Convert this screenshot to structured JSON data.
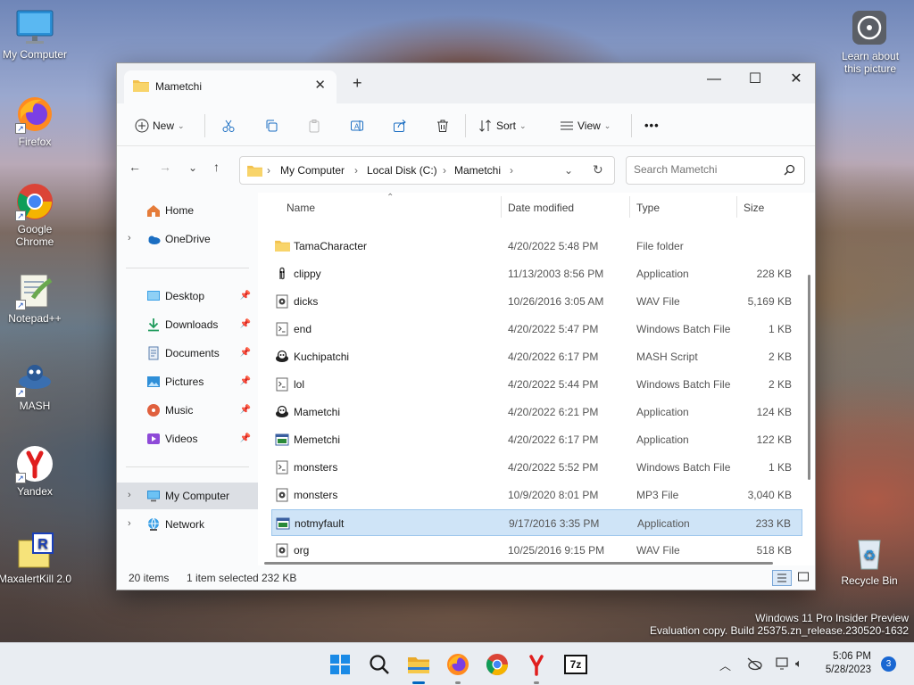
{
  "desktop": {
    "icons": [
      {
        "label": "My Computer"
      },
      {
        "label": "Firefox"
      },
      {
        "label": "Google Chrome"
      },
      {
        "label": "Notepad++"
      },
      {
        "label": "MASH"
      },
      {
        "label": "Yandex"
      },
      {
        "label": "MaxalertKill 2.0"
      },
      {
        "label": "Learn about this picture"
      },
      {
        "label": "Recycle Bin"
      }
    ],
    "watermark_line1": "Windows 11 Pro Insider Preview",
    "watermark_line2": "Evaluation copy. Build 25375.zn_release.230520-1632"
  },
  "window": {
    "tab_title": "Mametchi",
    "toolbar": {
      "new_label": "New",
      "sort_label": "Sort",
      "view_label": "View",
      "more_label": "•••"
    },
    "address": {
      "crumbs": [
        "My Computer",
        "Local Disk (C:)",
        "Mametchi"
      ]
    },
    "search_placeholder": "Search Mametchi",
    "nav": {
      "home": "Home",
      "onedrive": "OneDrive",
      "quick": [
        "Desktop",
        "Downloads",
        "Documents",
        "Pictures",
        "Music",
        "Videos"
      ],
      "my_computer": "My Computer",
      "network": "Network"
    },
    "columns": {
      "name": "Name",
      "date": "Date modified",
      "type": "Type",
      "size": "Size"
    },
    "files": [
      {
        "name": "TamaCharacter",
        "date": "4/20/2022 5:48 PM",
        "type": "File folder",
        "size": "",
        "icon": "folder-icon"
      },
      {
        "name": "clippy",
        "date": "11/13/2003 8:56 PM",
        "type": "Application",
        "size": "228 KB",
        "icon": "clippy-icon"
      },
      {
        "name": "dicks",
        "date": "10/26/2016 3:05 AM",
        "type": "WAV File",
        "size": "5,169 KB",
        "icon": "audio-file-icon"
      },
      {
        "name": "end",
        "date": "4/20/2022 5:47 PM",
        "type": "Windows Batch File",
        "size": "1 KB",
        "icon": "batch-file-icon"
      },
      {
        "name": "Kuchipatchi",
        "date": "4/20/2022 6:17 PM",
        "type": "MASH Script",
        "size": "2 KB",
        "icon": "mash-icon"
      },
      {
        "name": "lol",
        "date": "4/20/2022 5:44 PM",
        "type": "Windows Batch File",
        "size": "2 KB",
        "icon": "batch-file-icon"
      },
      {
        "name": "Mametchi",
        "date": "4/20/2022 6:21 PM",
        "type": "Application",
        "size": "124 KB",
        "icon": "mash-icon"
      },
      {
        "name": "Memetchi",
        "date": "4/20/2022 6:17 PM",
        "type": "Application",
        "size": "122 KB",
        "icon": "app-icon"
      },
      {
        "name": "monsters",
        "date": "4/20/2022 5:52 PM",
        "type": "Windows Batch File",
        "size": "1 KB",
        "icon": "batch-file-icon"
      },
      {
        "name": "monsters",
        "date": "10/9/2020 8:01 PM",
        "type": "MP3 File",
        "size": "3,040 KB",
        "icon": "audio-file-icon"
      },
      {
        "name": "notmyfault",
        "date": "9/17/2016 3:35 PM",
        "type": "Application",
        "size": "233 KB",
        "icon": "app-icon",
        "selected": true
      },
      {
        "name": "org",
        "date": "10/25/2016 9:15 PM",
        "type": "WAV File",
        "size": "518 KB",
        "icon": "audio-file-icon"
      }
    ],
    "status": {
      "items": "20 items",
      "selected": "1 item selected",
      "selected_size": "232 KB"
    }
  },
  "taskbar": {
    "time": "5:06 PM",
    "date": "5/28/2023",
    "notification_count": "3",
    "app_7z_label": "7z"
  },
  "colors": {
    "accent": "#0067c0",
    "selection": "#cfe4f7",
    "folder": "#f2c14e"
  }
}
